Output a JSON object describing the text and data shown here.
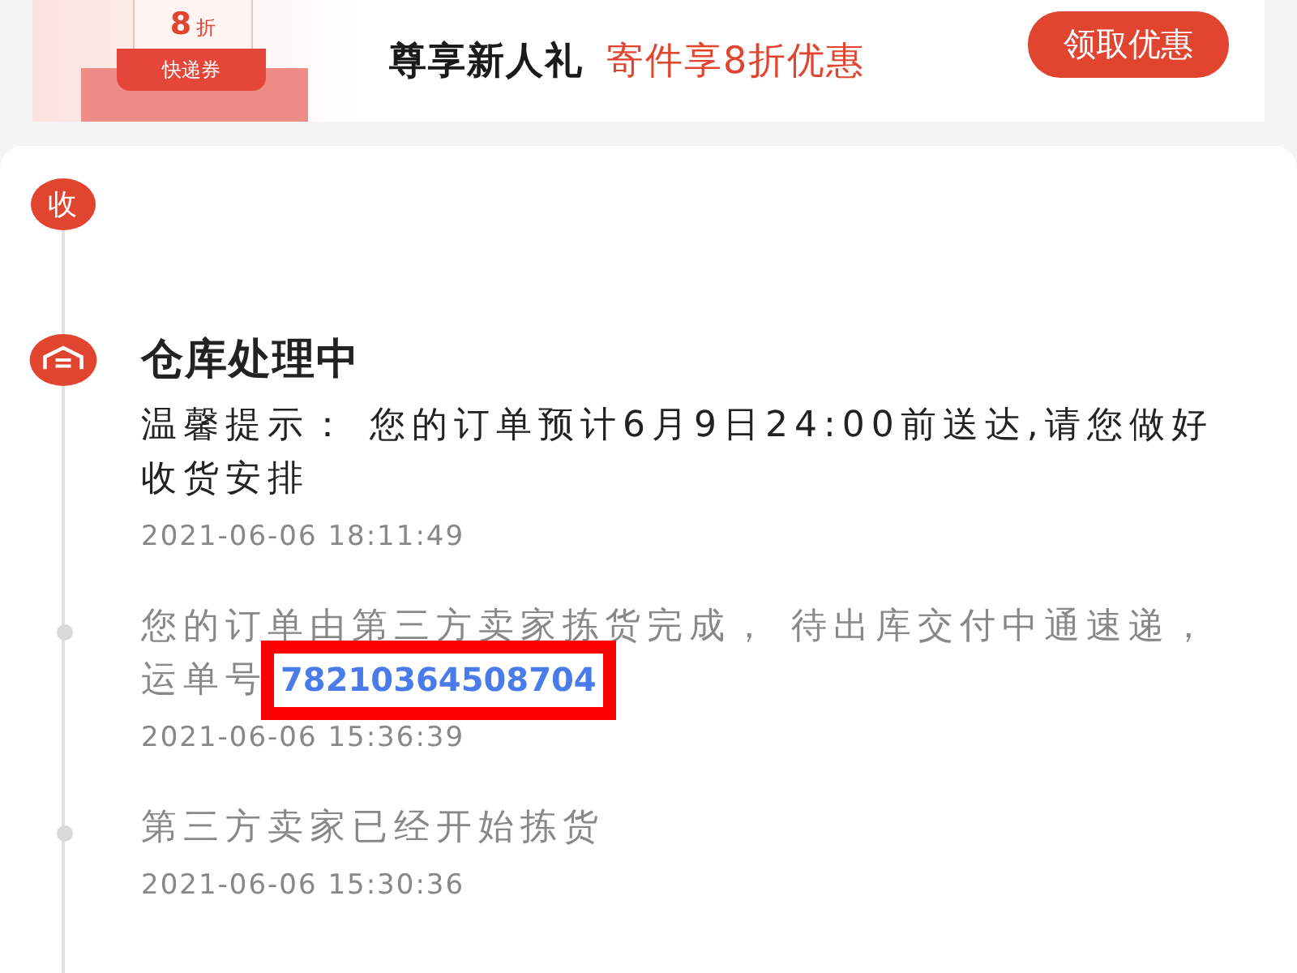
{
  "banner": {
    "coupon": {
      "amount": "8",
      "unit": "折",
      "label": "快递券"
    },
    "title": "尊享新人礼",
    "offer": "寄件享8折优惠",
    "button": "领取优惠"
  },
  "timeline": [
    {
      "kind": "badge",
      "badge": "收"
    },
    {
      "kind": "warehouse",
      "title": "仓库处理中",
      "text": "温馨提示：  您的订单预计6月9日24:00前送达,请您做好收货安排",
      "time": "2021-06-06 18:11:49"
    },
    {
      "kind": "dot",
      "text": "您的订单由第三方卖家拣货完成， 待出库交付中通速递，运单号",
      "tracking_number": "78210364508704",
      "highlighted": true,
      "time": "2021-06-06 15:36:39"
    },
    {
      "kind": "dot",
      "text": "第三方卖家已经开始拣货",
      "time": "2021-06-06 15:30:36"
    }
  ]
}
